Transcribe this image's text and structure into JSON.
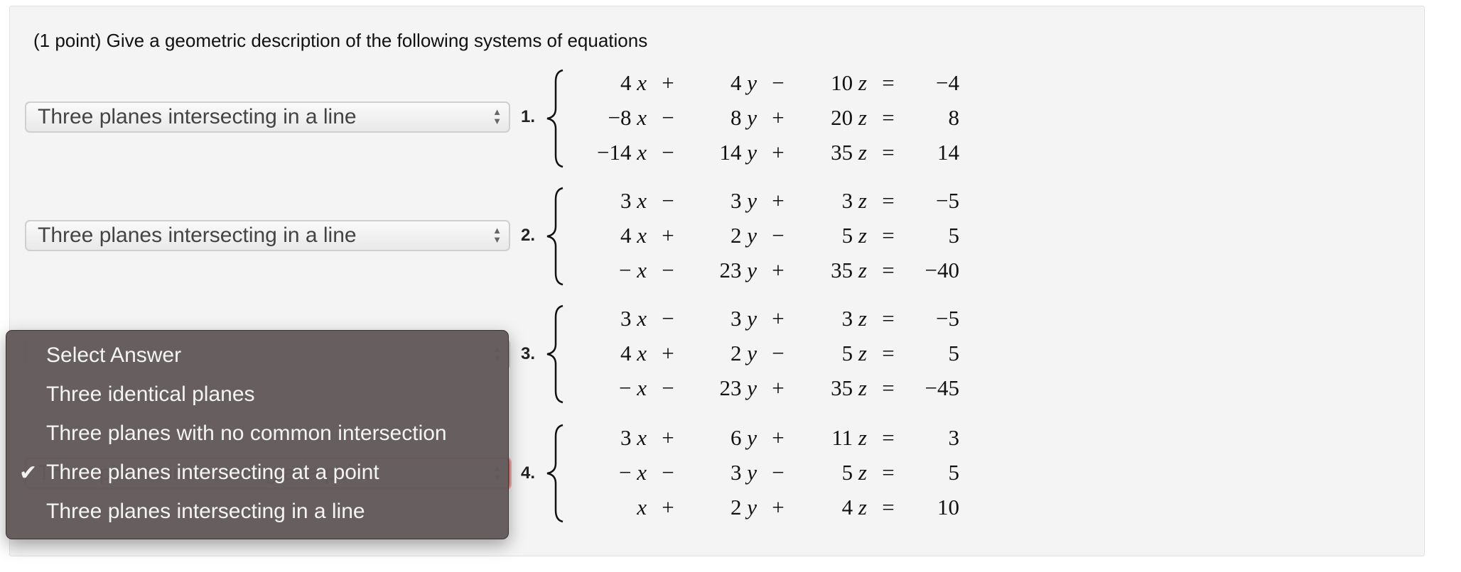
{
  "prompt": "(1 point) Give a geometric description of the following systems of equations",
  "problems": [
    {
      "label": "1.",
      "answer": "Three planes intersecting in a line",
      "rows": [
        [
          "4",
          "x",
          "+",
          "4",
          "y",
          "−",
          "10",
          "z",
          "=",
          "−4"
        ],
        [
          "−8",
          "x",
          "−",
          "8",
          "y",
          "+",
          "20",
          "z",
          "=",
          "8"
        ],
        [
          "−14",
          "x",
          "−",
          "14",
          "y",
          "+",
          "35",
          "z",
          "=",
          "14"
        ]
      ]
    },
    {
      "label": "2.",
      "answer": "Three planes intersecting in a line",
      "rows": [
        [
          "3",
          "x",
          "−",
          "3",
          "y",
          "+",
          "3",
          "z",
          "=",
          "−5"
        ],
        [
          "4",
          "x",
          "+",
          "2",
          "y",
          "−",
          "5",
          "z",
          "=",
          "5"
        ],
        [
          "−",
          "x",
          "−",
          "23",
          "y",
          "+",
          "35",
          "z",
          "=",
          "−40"
        ]
      ]
    },
    {
      "label": "3.",
      "answer": "",
      "rows": [
        [
          "3",
          "x",
          "−",
          "3",
          "y",
          "+",
          "3",
          "z",
          "=",
          "−5"
        ],
        [
          "4",
          "x",
          "+",
          "2",
          "y",
          "−",
          "5",
          "z",
          "=",
          "5"
        ],
        [
          "−",
          "x",
          "−",
          "23",
          "y",
          "+",
          "35",
          "z",
          "=",
          "−45"
        ]
      ]
    },
    {
      "label": "4.",
      "answer": "Three planes intersecting at a point",
      "rows": [
        [
          "3",
          "x",
          "+",
          "6",
          "y",
          "+",
          "11",
          "z",
          "=",
          "3"
        ],
        [
          "−",
          "x",
          "−",
          "3",
          "y",
          "−",
          "5",
          "z",
          "=",
          "5"
        ],
        [
          "",
          "x",
          "+",
          "2",
          "y",
          "+",
          "4",
          "z",
          "=",
          "10"
        ]
      ]
    }
  ],
  "menu": {
    "options": [
      "Select Answer",
      "Three identical planes",
      "Three planes with no common intersection",
      "Three planes intersecting at a point",
      "Three planes intersecting in a line"
    ],
    "selected_index": 3,
    "check_icon": "✔"
  },
  "colors": {
    "menu_bg": "#625a5a",
    "focus_border": "#e08080"
  }
}
